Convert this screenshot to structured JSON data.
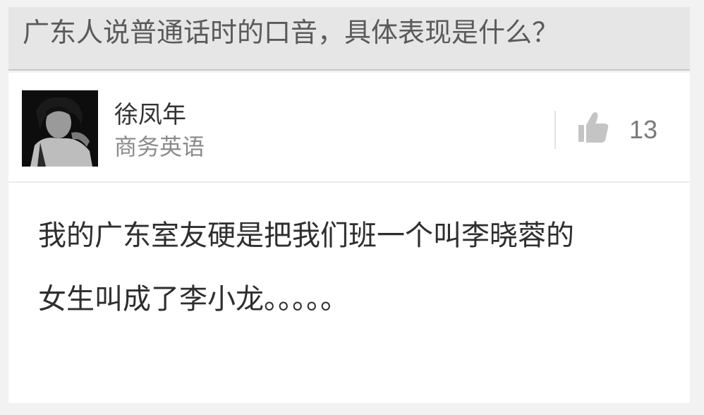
{
  "question": {
    "title": "广东人说普通话时的口音，具体表现是什么？"
  },
  "answer": {
    "author": {
      "name": "徐凤年",
      "bio": "商务英语"
    },
    "vote": {
      "icon": "thumb-up-icon",
      "count": "13"
    },
    "content_lines": [
      "我的广东室友硬是把我们班一个叫李晓蓉的",
      "女生叫成了李小龙。。。。。"
    ]
  },
  "colors": {
    "background": "#f2f2f2",
    "question_bar": "#e6e6e6",
    "card": "#ffffff",
    "text_primary": "#2e2e2e",
    "text_secondary": "#8a8a8a"
  }
}
